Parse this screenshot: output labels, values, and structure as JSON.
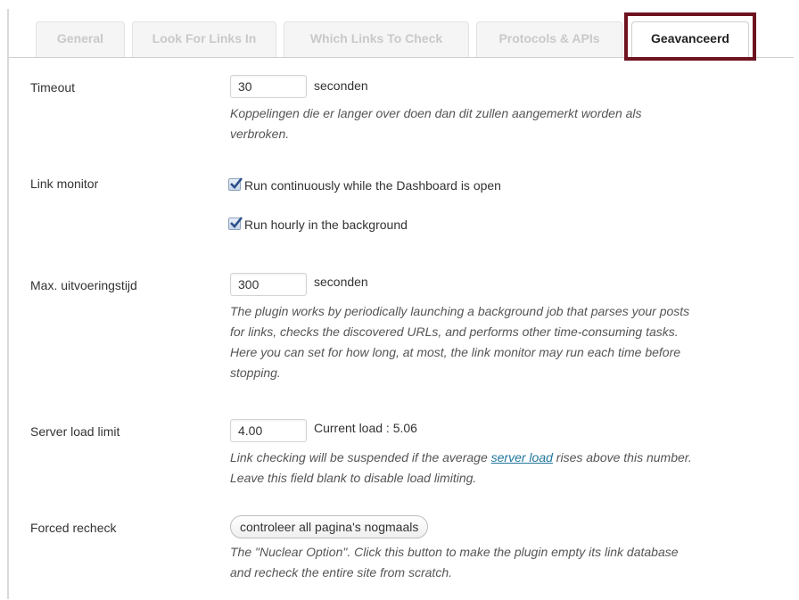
{
  "tabs": [
    {
      "label": "General",
      "active": false
    },
    {
      "label": "Look For Links In",
      "active": false
    },
    {
      "label": "Which Links To Check",
      "active": false
    },
    {
      "label": "Protocols & APIs",
      "active": false
    },
    {
      "label": "Geavanceerd",
      "active": true
    }
  ],
  "highlight_color": "#6e1220",
  "timeout": {
    "label": "Timeout",
    "value": "30",
    "unit": "seconden",
    "desc_line1": "Koppelingen die er langer over doen dan dit zullen aangemerkt worden als",
    "desc_line2": "verbroken."
  },
  "link_monitor": {
    "label": "Link monitor",
    "option1": {
      "text": "Run continuously while the Dashboard is open",
      "checked": true
    },
    "option2": {
      "text": "Run hourly in the background",
      "checked": true
    }
  },
  "max_exec": {
    "label": "Max. uitvoeringstijd",
    "value": "300",
    "unit": "seconden",
    "desc_lines": [
      "The plugin works by periodically launching a background job that parses your posts",
      "for links, checks the discovered URLs, and performs other time-consuming tasks.",
      "Here you can set for how long, at most, the link monitor may run each time before",
      "stopping."
    ]
  },
  "server_load": {
    "label": "Server load limit",
    "value": "4.00",
    "current_label": "Current load :",
    "current_value": "5.06",
    "desc_pre": "Link checking will be suspended if the average ",
    "desc_link": "server load",
    "desc_post": " rises above this number.",
    "desc_line2": "Leave this field blank to disable load limiting."
  },
  "recheck": {
    "label": "Forced recheck",
    "button_label": "controleer all pagina's nogmaals",
    "desc_line1": "The \"Nuclear Option\". Click this button to make the plugin empty its link database",
    "desc_line2": "and recheck the entire site from scratch."
  }
}
